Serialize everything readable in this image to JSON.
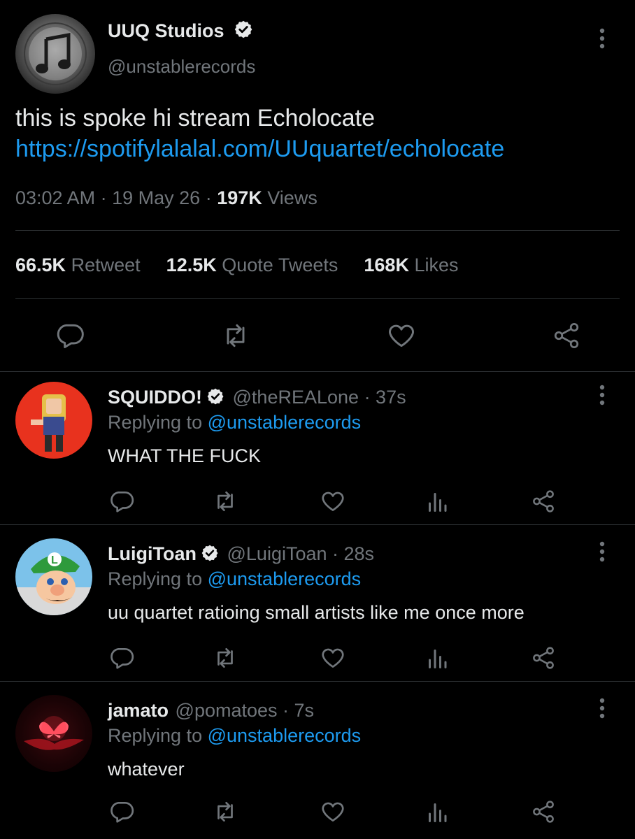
{
  "main_tweet": {
    "display_name": "UUQ Studios",
    "handle": "@unstablerecords",
    "text": "this is spoke hi stream Echolocate",
    "link": "https://spotifylalalal.com/UUquartet/echolocate",
    "time": "03:02 AM",
    "sep1": "·",
    "date": "19 May 26",
    "sep2": "·",
    "views_count": "197K",
    "views_label": "Views",
    "stats": {
      "retweets_count": "66.5K",
      "retweets_label": "Retweet",
      "quotes_count": "12.5K",
      "quotes_label": "Quote Tweets",
      "likes_count": "168K",
      "likes_label": "Likes"
    }
  },
  "replies": [
    {
      "display_name": "SQUIDDO!",
      "verified": true,
      "handle": "@theREALone",
      "time": "· 37s",
      "replying_label": "Replying to",
      "replying_to": "@unstablerecords",
      "text": "WHAT THE FUCK",
      "avatar_color": "#e8321e"
    },
    {
      "display_name": "LuigiToan",
      "verified": true,
      "handle": "@LuigiToan",
      "time": "· 28s",
      "replying_label": "Replying to",
      "replying_to": "@unstablerecords",
      "text": "uu quartet ratioing small artists like me once more",
      "avatar_color": "#2f9a3a"
    },
    {
      "display_name": "jamato",
      "verified": false,
      "handle": "@pomatoes",
      "time": "· 7s",
      "replying_label": "Replying to",
      "replying_to": "@unstablerecords",
      "text": "whatever",
      "avatar_color": "#2a0608"
    }
  ],
  "colors": {
    "background": "#000000",
    "text": "#e7e9ea",
    "muted": "#71767b",
    "link": "#1d9bf0",
    "divider": "#2f3336"
  }
}
